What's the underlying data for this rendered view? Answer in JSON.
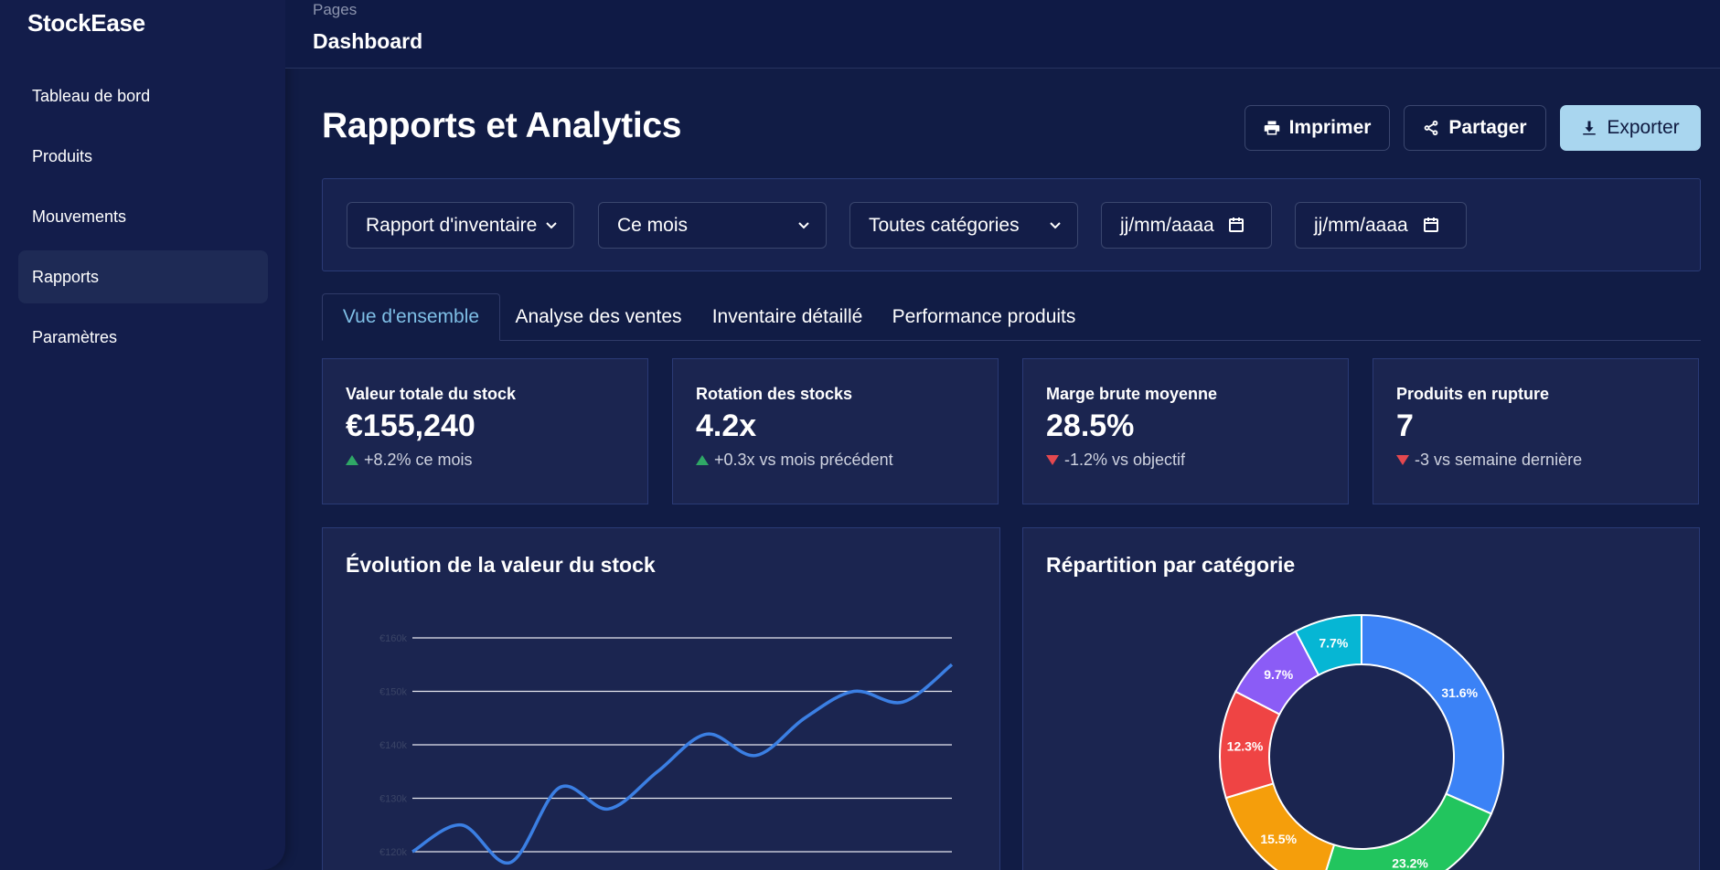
{
  "sidebar": {
    "brand": "StockEase",
    "items": [
      {
        "label": "Tableau de bord",
        "active": false
      },
      {
        "label": "Produits",
        "active": false
      },
      {
        "label": "Mouvements",
        "active": false
      },
      {
        "label": "Rapports",
        "active": true
      },
      {
        "label": "Paramètres",
        "active": false
      }
    ]
  },
  "topbar": {
    "breadcrumb": "Pages",
    "title": "Dashboard"
  },
  "header": {
    "title": "Rapports et Analytics",
    "buttons": {
      "print": "Imprimer",
      "share": "Partager",
      "export": "Exporter"
    }
  },
  "filters": {
    "report_type": "Rapport d'inventaire",
    "period": "Ce mois",
    "category": "Toutes catégories",
    "date_from": "jj/mm/aaaa",
    "date_to": "jj/mm/aaaa"
  },
  "tabs": [
    {
      "label": "Vue d'ensemble",
      "active": true
    },
    {
      "label": "Analyse des ventes",
      "active": false
    },
    {
      "label": "Inventaire détaillé",
      "active": false
    },
    {
      "label": "Performance produits",
      "active": false
    }
  ],
  "kpis": [
    {
      "label": "Valeur totale du stock",
      "value": "€155,240",
      "delta": "+8.2% ce mois",
      "trend": "up"
    },
    {
      "label": "Rotation des stocks",
      "value": "4.2x",
      "delta": "+0.3x vs mois précédent",
      "trend": "up"
    },
    {
      "label": "Marge brute moyenne",
      "value": "28.5%",
      "delta": "-1.2% vs objectif",
      "trend": "down"
    },
    {
      "label": "Produits en rupture",
      "value": "7",
      "delta": "-3 vs semaine dernière",
      "trend": "down"
    }
  ],
  "colors": {
    "accent": "#a9d6ef",
    "line": "#3b7fe3",
    "up": "#2fa866",
    "down": "#e4484f"
  },
  "chart_data": [
    {
      "type": "line",
      "title": "Évolution de la valeur du stock",
      "yticks": [
        "€120k",
        "€130k",
        "€140k",
        "€150k",
        "€160k"
      ],
      "ylim": [
        120,
        160
      ],
      "y_unit": "k€",
      "series": [
        {
          "values": [
            120,
            125,
            118,
            132,
            128,
            135,
            142,
            138,
            145,
            150,
            148,
            155
          ]
        }
      ],
      "grid": true
    },
    {
      "type": "pie",
      "title": "Répartition par catégorie",
      "donut": true,
      "slices": [
        {
          "label": "31.6%",
          "value": 31.6,
          "color": "#3b82f6"
        },
        {
          "label": "23.2%",
          "value": 23.2,
          "color": "#22c55e"
        },
        {
          "label": "15.5%",
          "value": 15.5,
          "color": "#f59e0b"
        },
        {
          "label": "12.3%",
          "value": 12.3,
          "color": "#ef4444"
        },
        {
          "label": "9.7%",
          "value": 9.7,
          "color": "#8b5cf6"
        },
        {
          "label": "7.7%",
          "value": 7.7,
          "color": "#06b6d4"
        }
      ]
    }
  ]
}
